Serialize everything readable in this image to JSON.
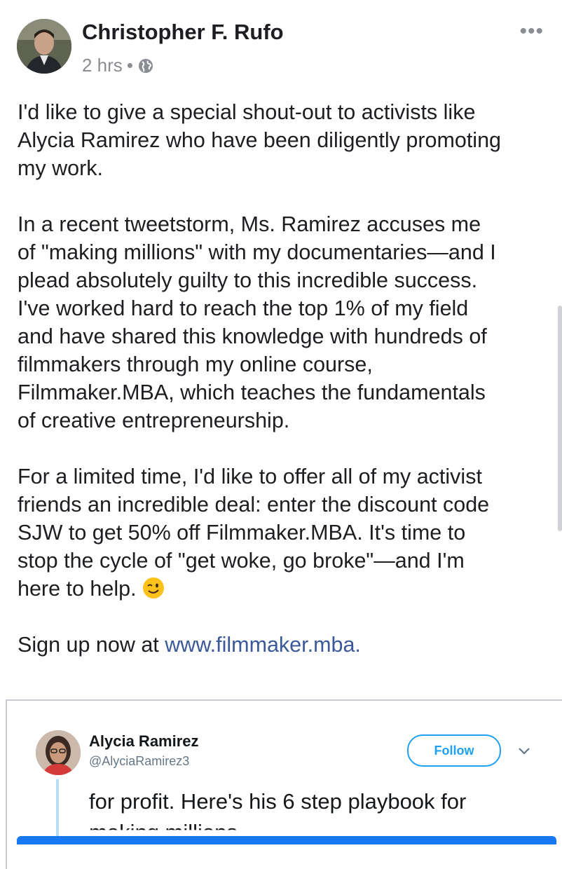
{
  "post": {
    "author": "Christopher F. Rufo",
    "time": "2 hrs",
    "separator": "•",
    "more_label": "•••",
    "paragraphs": [
      [
        "I'd like to give a special shout-out to activists like",
        "Alycia Ramirez who have been diligently promoting",
        "my work."
      ],
      [
        "In a recent tweetstorm, Ms. Ramirez accuses me",
        "of \"making millions\" with my documentaries—and I",
        "plead absolutely guilty to this incredible success.",
        "I've worked hard to reach the top 1% of my field",
        "and have shared this knowledge with hundreds of",
        "filmmakers through my online course,",
        "Filmmaker.MBA, which teaches the fundamentals",
        "of creative entrepreneurship."
      ],
      [
        "For a limited time, I'd like to offer all of my activist",
        "friends an incredible deal: enter the discount code",
        "SJW to get 50% off Filmmaker.MBA. It's time to",
        "stop the cycle of \"get woke, go broke\"—and I'm"
      ],
      [
        "here to help."
      ]
    ],
    "signup_prefix": "Sign up now at ",
    "signup_link": "www.filmmaker.mba."
  },
  "tweet": {
    "name": "Alycia Ramirez",
    "handle": "@AlyciaRamirez3",
    "follow_label": "Follow",
    "text_line1": "for profit. Here's his 6 step playbook for",
    "text_line2": "making millions"
  },
  "icons": {
    "globe": "globe-icon",
    "wink": "winking-face-emoji",
    "chevron": "chevron-down-icon"
  },
  "colors": {
    "link": "#3b5998",
    "follow": "#1da1f2",
    "meta": "#8a8d91"
  }
}
